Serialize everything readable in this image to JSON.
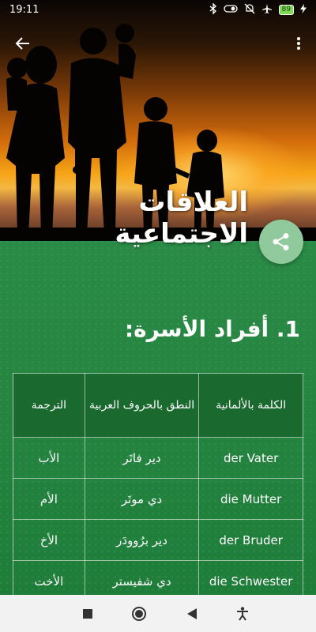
{
  "status_bar": {
    "time": "19:11",
    "battery": "89",
    "icons": [
      "bluetooth-icon",
      "toggle-icon",
      "mute-icon",
      "airplane-icon",
      "battery-icon",
      "charging-icon"
    ]
  },
  "header": {
    "title": "العلاقات الاجتماعية",
    "back_icon": "arrow-left-icon",
    "menu_icon": "more-vert-icon",
    "share_icon": "share-icon"
  },
  "section": {
    "title": "1. أفراد الأسرة:"
  },
  "table": {
    "headers": {
      "word": "الكلمة بالألمانية",
      "pronunciation": "النطق بالحروف العربية",
      "translation": "الترجمة"
    },
    "rows": [
      {
        "word": "der Vater",
        "pronunciation": "دير فاتَر",
        "translation": "الأب"
      },
      {
        "word": "die Mutter",
        "pronunciation": "دي موتَر",
        "translation": "الأم"
      },
      {
        "word": "der Bruder",
        "pronunciation": "دير برُوودَر",
        "translation": "الأخ"
      },
      {
        "word": "die Schwester",
        "pronunciation": "دي شفيستر",
        "translation": "الأخت"
      }
    ]
  },
  "nav": {
    "icons": [
      "recent-apps-icon",
      "home-icon",
      "back-icon",
      "accessibility-icon"
    ]
  },
  "colors": {
    "green": "#1f7d3a",
    "fab": "#8fc99c"
  }
}
